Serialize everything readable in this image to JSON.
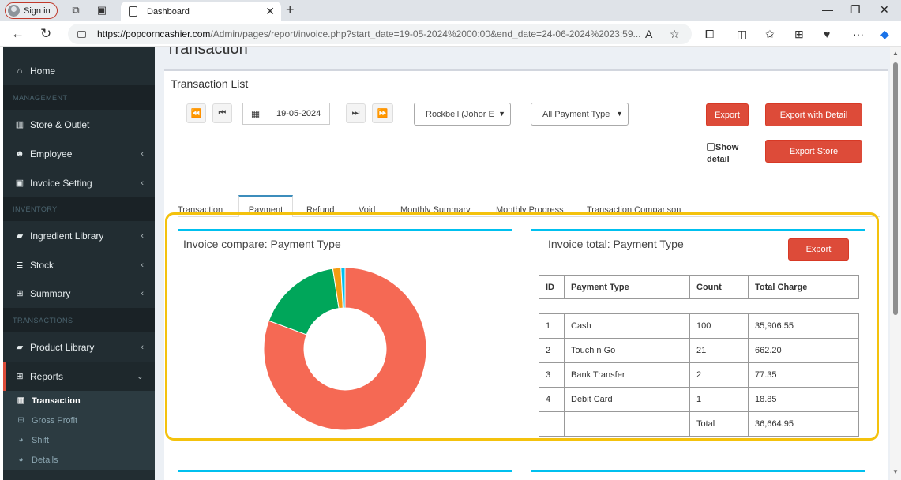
{
  "browser": {
    "signin_label": "Sign in",
    "tab_title": "Dashboard",
    "url_host": "https://popcorncashier.com",
    "url_path": "/Admin/pages/report/invoice.php?start_date=19-05-2024%2000:00&end_date=24-06-2024%2023:59..."
  },
  "sidebar": {
    "home": "Home",
    "header_management": "MANAGEMENT",
    "store_outlet": "Store & Outlet",
    "employee": "Employee",
    "invoice_setting": "Invoice Setting",
    "header_inventory": "INVENTORY",
    "ingredient_library": "Ingredient Library",
    "stock": "Stock",
    "summary": "Summary",
    "header_transactions": "TRANSACTIONS",
    "product_library": "Product Library",
    "reports": "Reports",
    "sub_transaction": "Transaction",
    "sub_gross_profit": "Gross Profit",
    "sub_shift": "Shift",
    "sub_details": "Details"
  },
  "page": {
    "title": "Transaction",
    "box_title": "Transaction List",
    "date_value": "19-05-2024",
    "outlet_select": "Rockbell (Johor E",
    "payment_select": "All Payment Type",
    "export_label": "Export",
    "export_detail_label": "Export with Detail",
    "export_store_label": "Export Store",
    "show_label": "Show",
    "detail_label": "detail"
  },
  "tabs": [
    "Transaction",
    "Payment",
    "Refund",
    "Void",
    "Monthly Summary",
    "Monthly Progress",
    "Transaction Comparison"
  ],
  "compare_panel": {
    "title": "Invoice compare: Payment Type"
  },
  "total_panel": {
    "title": "Invoice total: Payment Type",
    "export_label": "Export",
    "headers": [
      "ID",
      "Payment Type",
      "Count",
      "Total Charge"
    ],
    "rows": [
      [
        "1",
        "Cash",
        "100",
        "35,906.55"
      ],
      [
        "2",
        "Touch n Go",
        "21",
        "662.20"
      ],
      [
        "3",
        "Bank Transfer",
        "2",
        "77.35"
      ],
      [
        "4",
        "Debit Card",
        "1",
        "18.85"
      ]
    ],
    "total_label": "Total",
    "total_value": "36,664.95"
  },
  "chart_data": {
    "type": "pie",
    "categories": [
      "Cash",
      "Touch n Go",
      "Bank Transfer",
      "Debit Card"
    ],
    "values": [
      100,
      21,
      2,
      1
    ],
    "colors": [
      "#f56954",
      "#00a65a",
      "#f39c12",
      "#00c0ef"
    ]
  }
}
